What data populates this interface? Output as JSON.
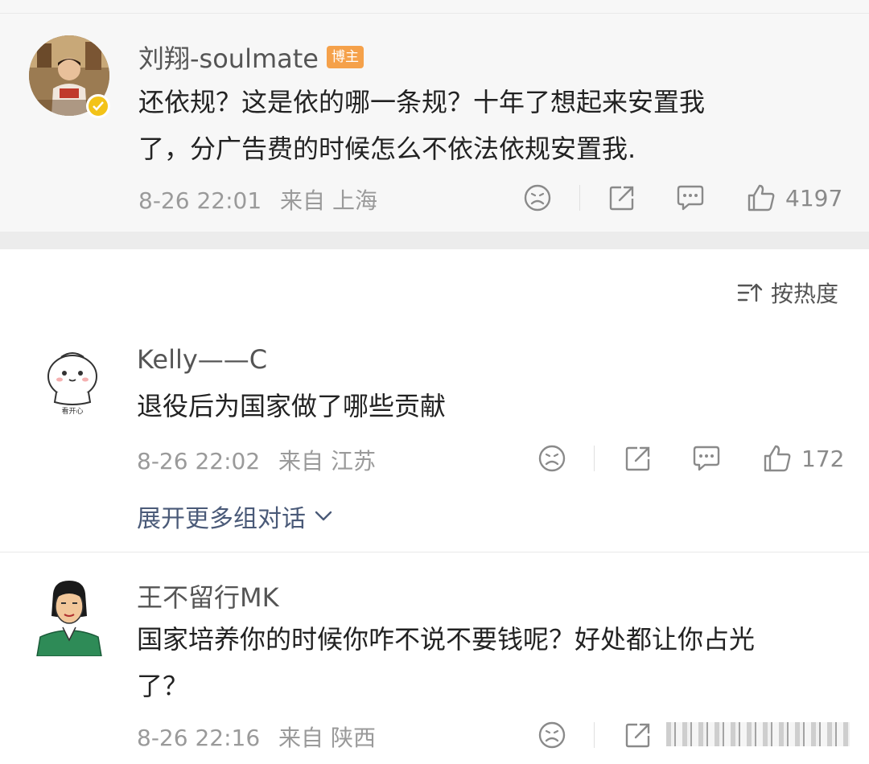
{
  "post": {
    "author": "刘翔-soulmate",
    "badge": "博主",
    "text_line1": "还依规？这是依的哪一条规？十年了想起来安置我",
    "text_line2": "了，分广告费的时候怎么不依法依规安置我.",
    "date": "8-26 22:01",
    "from": "来自 上海",
    "likes": "4197"
  },
  "sort": {
    "label": "按热度"
  },
  "comments": [
    {
      "author": "Kelly——C",
      "text": "退役后为国家做了哪些贡献",
      "date": "8-26 22:02",
      "from": "来自 江苏",
      "likes": "172",
      "avatar_caption": "看开心"
    },
    {
      "author": "王不留行MK",
      "text_line1": "国家培养你的时候你咋不说不要钱呢？好处都让你占光",
      "text_line2": "了？",
      "date": "8-26 22:16",
      "from": "来自 陕西"
    }
  ],
  "expand": {
    "label": "展开更多组对话"
  },
  "icons": [
    "sad-face-icon",
    "share-icon",
    "comment-icon",
    "thumbs-up-icon",
    "sort-icon",
    "chevron-down-icon",
    "verified-icon"
  ]
}
